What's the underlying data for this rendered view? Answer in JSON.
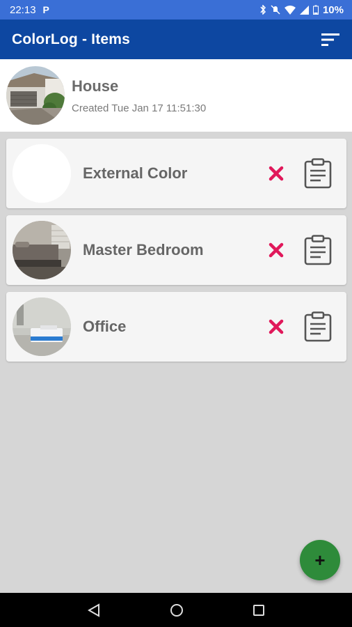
{
  "status_bar": {
    "time": "22:13",
    "notification_icon": "parking-icon",
    "battery": "10%",
    "icons": [
      "bluetooth-icon",
      "mute-icon",
      "wifi-icon",
      "signal-icon",
      "battery-icon"
    ]
  },
  "app_bar": {
    "title": "ColorLog - Items",
    "sort_icon": "sort-icon",
    "color": "#0d47a1"
  },
  "header": {
    "name": "House",
    "created": "Created Tue Jan 17 11:51:30"
  },
  "items": [
    {
      "label": "External Color",
      "thumb": "blank"
    },
    {
      "label": "Master Bedroom",
      "thumb": "bedroom"
    },
    {
      "label": "Office",
      "thumb": "office"
    }
  ],
  "item_actions": {
    "delete_icon": "close-icon",
    "delete_color": "#e0185a",
    "details_icon": "clipboard-icon"
  },
  "fab": {
    "label": "+",
    "color": "#2e8b3a"
  },
  "nav_bar": {
    "buttons": [
      "back-icon",
      "home-icon",
      "recents-icon"
    ]
  }
}
